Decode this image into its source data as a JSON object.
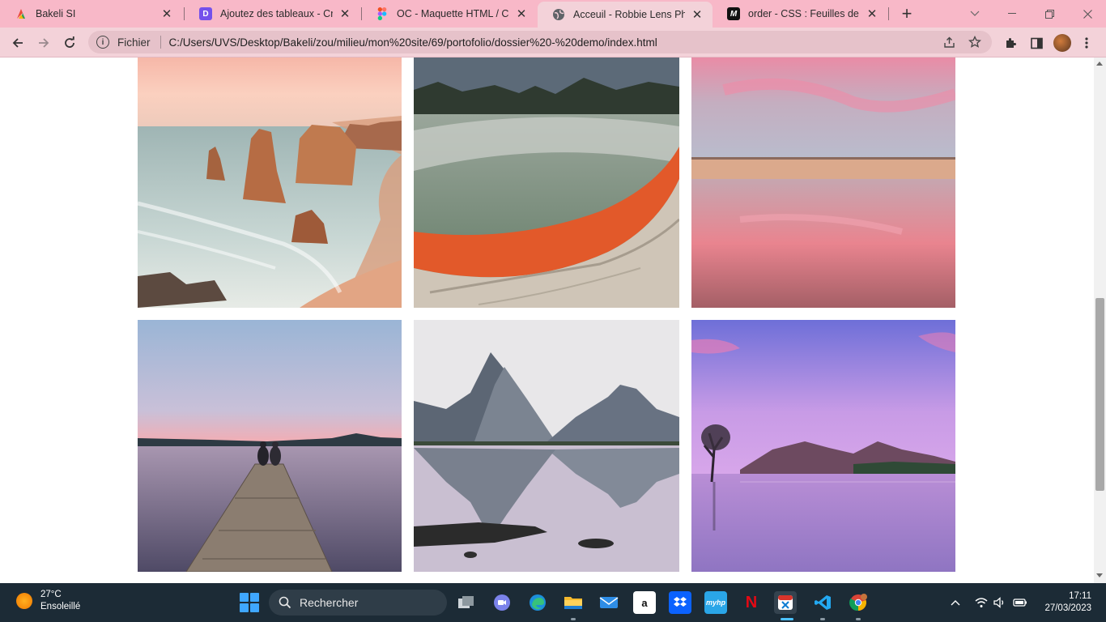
{
  "tabs": [
    {
      "title": "Bakeli SI",
      "icon": "bakeli-icon",
      "active": false
    },
    {
      "title": "Ajoutez des tableaux - Créez",
      "icon": "openclassrooms-icon",
      "active": false
    },
    {
      "title": "OC - Maquette HTML / CSS d",
      "icon": "figma-icon",
      "active": false
    },
    {
      "title": "Acceuil - Robbie Lens Photog",
      "icon": "globe-icon",
      "active": true
    },
    {
      "title": "order - CSS : Feuilles de style",
      "icon": "mdn-icon",
      "active": false
    }
  ],
  "toolbar": {
    "scheme_label": "Fichier",
    "url": "C:/Users/UVS/Desktop/Bakeli/zou/milieu/mon%20site/69/portofolio/dossier%20-%20demo/index.html"
  },
  "gallery": {
    "photos": [
      {
        "name": "photo-twelve-apostles",
        "alt": "Sea stacks on a rocky coast at sunrise"
      },
      {
        "name": "photo-geothermal-pool",
        "alt": "Steaming geothermal pool with orange rim"
      },
      {
        "name": "photo-pink-beach",
        "alt": "Pink sky reflected on wet beach"
      },
      {
        "name": "photo-pier-couple",
        "alt": "Couple sitting at the end of a wooden pier"
      },
      {
        "name": "photo-fjord-mountains",
        "alt": "Mountains reflected in a calm fjord"
      },
      {
        "name": "photo-lone-tree-lake",
        "alt": "Lone tree in a purple lake at dusk"
      }
    ]
  },
  "taskbar": {
    "weather_temp": "27°C",
    "weather_desc": "Ensoleillé",
    "search_placeholder": "Rechercher",
    "time": "17:11",
    "date": "27/03/2023"
  },
  "colors": {
    "tab_strip": "#f8b8c8",
    "toolbar": "#f3d2d9",
    "taskbar": "#1c2b36"
  }
}
